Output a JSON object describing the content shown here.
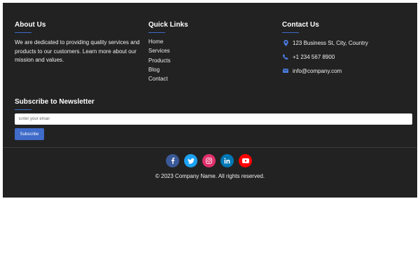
{
  "about": {
    "heading": "About Us",
    "text": "We are dedicated to providing quality services and products to our customers. Learn more about our mission and values."
  },
  "quick_links": {
    "heading": "Quick Links",
    "items": [
      "Home",
      "Services",
      "Products",
      "Blog",
      "Contact"
    ]
  },
  "contact": {
    "heading": "Contact Us",
    "address": "123 Business St, City, Country",
    "phone": "+1 234 567 8900",
    "email": "info@company.com",
    "icons": [
      "map-marker-icon",
      "phone-icon",
      "envelope-icon"
    ]
  },
  "newsletter": {
    "heading": "Subscribe to Newsletter",
    "placeholder": "Enter your email",
    "button_label": "Subscribe"
  },
  "social": [
    {
      "name": "facebook-icon",
      "color": "#3b5998",
      "glyph": "f"
    },
    {
      "name": "twitter-icon",
      "color": "#1da1f2",
      "glyph": ""
    },
    {
      "name": "instagram-icon",
      "color": "#e1306c",
      "glyph": ""
    },
    {
      "name": "linkedin-icon",
      "color": "#0077b5",
      "glyph": "in"
    },
    {
      "name": "youtube-icon",
      "color": "#ff0000",
      "glyph": ""
    }
  ],
  "copyright": "© 2023 Company Name. All rights reserved.",
  "colors": {
    "footer_bg": "#222222",
    "accent": "#3f6bc9"
  }
}
